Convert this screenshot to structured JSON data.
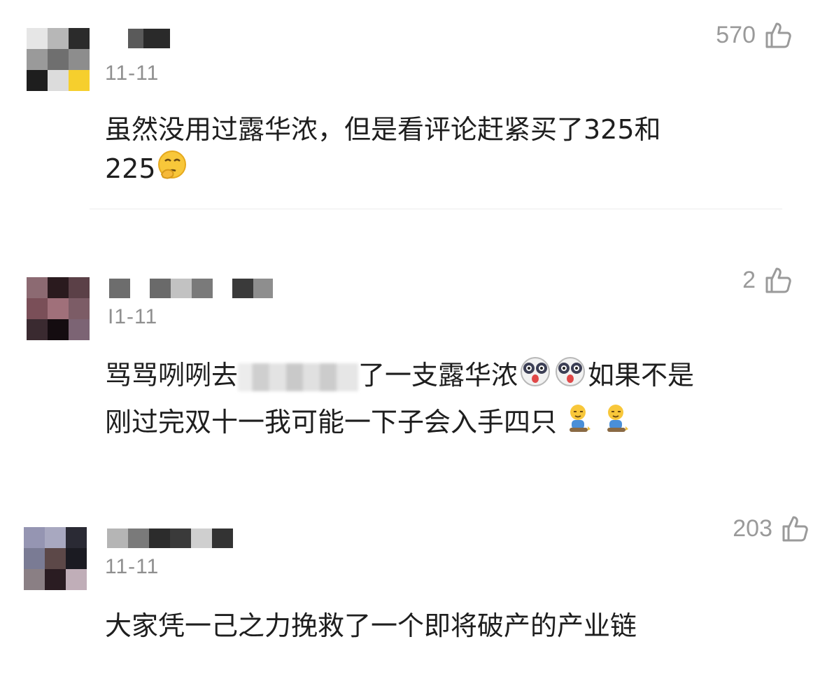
{
  "comments": [
    {
      "date": "11-11",
      "likes": "570",
      "text_line1": "虽然没用过露华浓，但是看评论赶紧买了325和",
      "text_line2": "225",
      "emoji": "thinking-face-emoji"
    },
    {
      "date": "I1-11",
      "likes": "2",
      "text_a": "骂骂咧咧去",
      "text_b": "了一支露华浓",
      "text_c": "如果不是",
      "text_line2": "刚过完双十一我可能一下子会入手四只",
      "emoji_a": "crazy-panda-emoji",
      "emoji_b": "sitting-kid-emoji"
    },
    {
      "date": "11-11",
      "likes": "203",
      "text_line1": "大家凭一己之力挽救了一个即将破产的产业链"
    }
  ],
  "colors": {
    "text": "#1e1e1e",
    "meta": "#8f8f8f",
    "divider": "#ececec"
  },
  "icons": [
    "thumbs-up-icon"
  ]
}
